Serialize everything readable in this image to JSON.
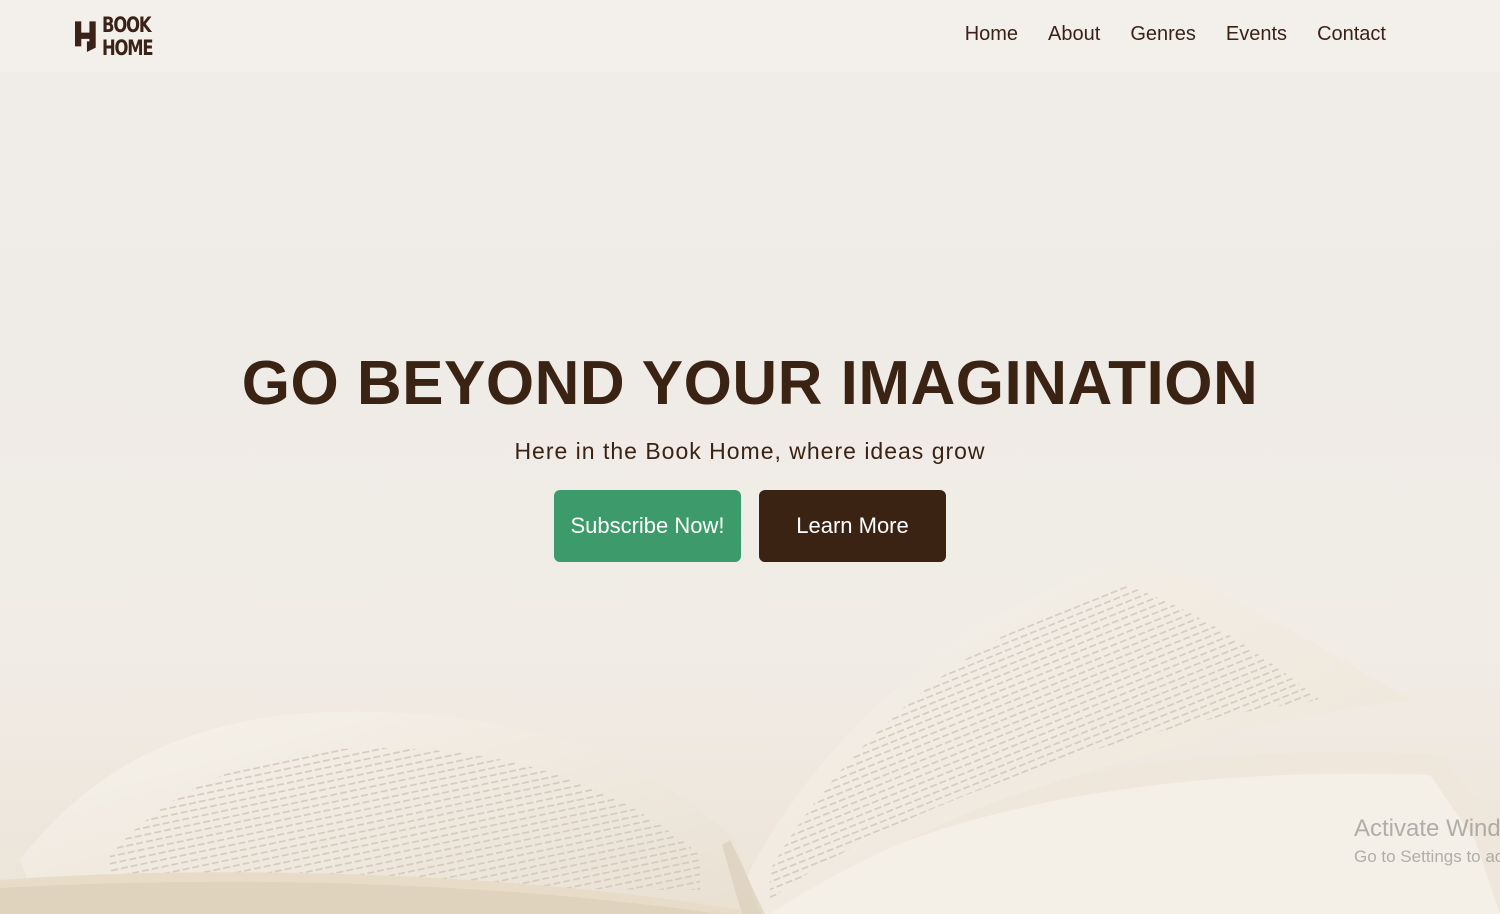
{
  "brand": {
    "logo_line1": "BOOK",
    "logo_line2": "HOME",
    "logo_icon": "house-h-icon"
  },
  "nav": {
    "items": [
      {
        "label": "Home"
      },
      {
        "label": "About"
      },
      {
        "label": "Genres"
      },
      {
        "label": "Events"
      },
      {
        "label": "Contact"
      }
    ]
  },
  "hero": {
    "title": "GO BEYOND YOUR IMAGINATION",
    "subtitle": "Here in the Book Home, where ideas grow",
    "subscribe_label": "Subscribe Now!",
    "learn_label": "Learn More",
    "background_image": "open-book-photo"
  },
  "watermark": {
    "title": "Activate Windows",
    "subtitle": "Go to Settings to activate Windows."
  },
  "colors": {
    "brand_brown": "#3b2314",
    "accent_green": "#3d9b6b",
    "background": "#efebe7"
  }
}
